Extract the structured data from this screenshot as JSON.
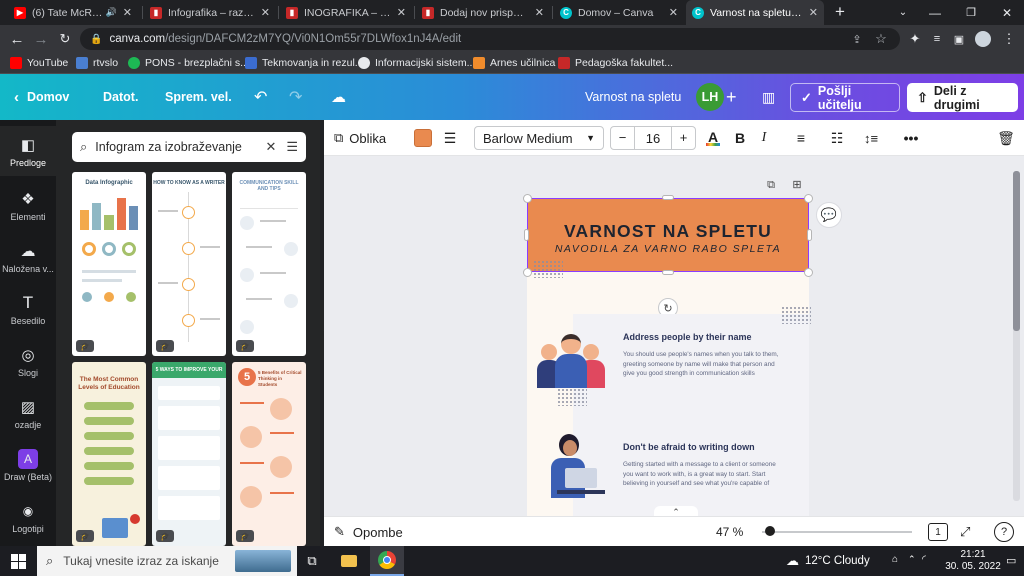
{
  "browser": {
    "tabs": [
      {
        "title": "(6) Tate McRae - s",
        "icon": "youtube-icon",
        "color": "#ff0000",
        "active": false
      },
      {
        "title": "Infografika – razrednik",
        "icon": "pdf-icon",
        "color": "#c62828",
        "active": false
      },
      {
        "title": "INOGRAFIKA – razred",
        "icon": "pdf-icon",
        "color": "#c62828",
        "active": false
      },
      {
        "title": "Dodaj nov prispevek",
        "icon": "pdf-icon",
        "color": "#c62828",
        "active": false
      },
      {
        "title": "Domov – Canva",
        "icon": "canva-icon",
        "color": "#00c4cc",
        "active": false
      },
      {
        "title": "Varnost na spletu – Inf",
        "icon": "canva-icon",
        "color": "#00c4cc",
        "active": true
      }
    ],
    "new_tab": "+",
    "url_domain": "canva.com",
    "url_path": "/design/DAFCM2zM7YQ/Vi0N1Om55r7DLWfox1nJ4A/edit",
    "bookmarks": [
      {
        "label": "YouTube",
        "color": "#ff0000"
      },
      {
        "label": "rtvslo",
        "color": "#4a7fd1"
      },
      {
        "label": "PONS - brezplačni s...",
        "color": "#1db954"
      },
      {
        "label": "Tekmovanja in rezul...",
        "color": "#3b6ccf"
      },
      {
        "label": "Informacijski sistem...",
        "color": "#e8eaed"
      },
      {
        "label": "Arnes učilnica",
        "color": "#f08c2c"
      },
      {
        "label": "Pedagoška fakultet...",
        "color": "#c62828"
      }
    ]
  },
  "canva": {
    "header": {
      "home": "Domov",
      "file": "Datot.",
      "resize": "Sprem. vel.",
      "title": "Varnost na spletu",
      "avatar": "LH",
      "send": "Pošlji učitelju",
      "share": "Deli z drugimi"
    },
    "rail": [
      {
        "label": "Predloge",
        "icon": "template-icon"
      },
      {
        "label": "Elementi",
        "icon": "shapes-icon"
      },
      {
        "label": "Naložena v...",
        "icon": "upload-icon"
      },
      {
        "label": "Besedilo",
        "icon": "text-icon"
      },
      {
        "label": "Slogi",
        "icon": "palette-icon"
      },
      {
        "label": "ozadje",
        "icon": "background-icon"
      },
      {
        "label": "Draw (Beta)",
        "icon": "draw-icon"
      },
      {
        "label": "Logotipi",
        "icon": "logo-icon"
      }
    ],
    "search": {
      "value": "Infogram za izobraževanje"
    },
    "thumbs": [
      {
        "title": "Data Infographic",
        "bg": "#ffffff",
        "accent": "#8fb8c4"
      },
      {
        "title": "HOW TO KNOW AS A WRITER",
        "bg": "#ffffff",
        "accent": "#f3a94b"
      },
      {
        "title": "COMMUNICATION SKILL AND TIPS",
        "bg": "#ffffff",
        "accent": "#6b8fb6"
      },
      {
        "title": "The Most Common Levels of Education",
        "bg": "#f7f1dd",
        "accent": "#a5c06a"
      },
      {
        "title": "5 WAYS TO IMPROVE YOUR",
        "bg": "#eef3f6",
        "accent": "#3aa86b"
      },
      {
        "title": "5 Benefits of Critical Thinking in Students",
        "bg": "#fdeee6",
        "accent": "#e8734a"
      }
    ],
    "toolbar": {
      "shape": "Oblika",
      "fill_color": "#e98a4f",
      "font": "Barlow Medium",
      "minus": "−",
      "font_size": "16",
      "plus": "+"
    },
    "design": {
      "title": "VARNOST NA SPLETU",
      "subtitle": "NAVODILA ZA VARNO RABO SPLETA",
      "banner_color": "#e98a4f",
      "cards": [
        {
          "title": "Address people by their name",
          "body": "You should use people's names when you talk to them, greeting someone by name will make that person and give you good strength in communication skills"
        },
        {
          "title": "Don't be afraid to writing down",
          "body": "Getting started with a message to a client or someone you want to work with, is a great way to start. Start believing in yourself and see what you're capable of"
        }
      ]
    },
    "bottom": {
      "notes": "Opombe",
      "zoom": "47 %",
      "zoom_fraction": 0.05,
      "page": "1"
    }
  },
  "taskbar": {
    "search": "Tukaj vnesite izraz za iskanje",
    "weather": "12°C  Cloudy",
    "time": "21:21",
    "date": "30. 05. 2022"
  }
}
